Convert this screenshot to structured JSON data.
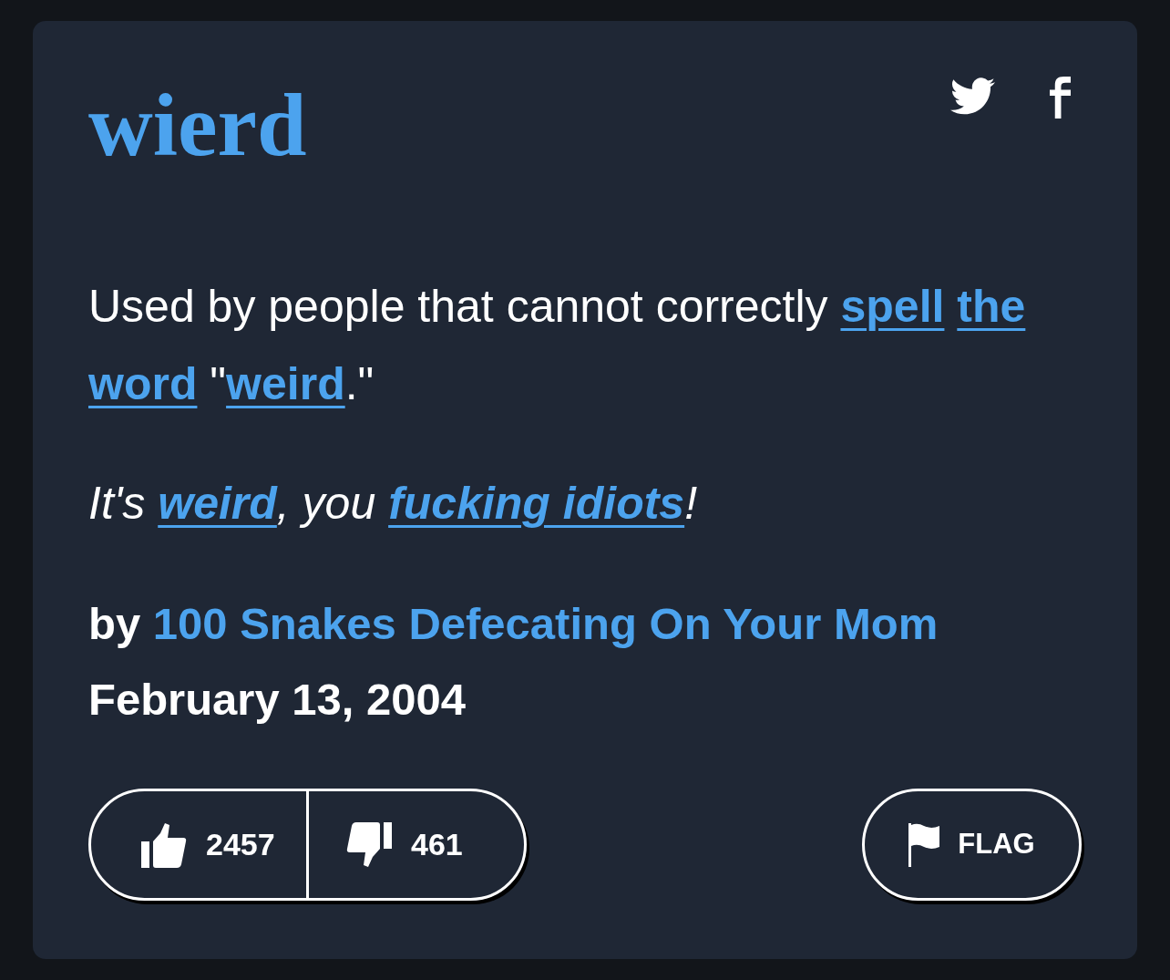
{
  "entry": {
    "word": "wierd"
  },
  "definition": [
    {
      "kind": "text",
      "text": "Used by people that cannot correctly "
    },
    {
      "kind": "link",
      "text": "spell",
      "space_after": true
    },
    {
      "kind": "link",
      "text": "the",
      "space_after": true
    },
    {
      "kind": "link",
      "text": "word"
    },
    {
      "kind": "text",
      "text": " \""
    },
    {
      "kind": "link",
      "text": "weird"
    },
    {
      "kind": "text",
      "text": ".\""
    }
  ],
  "example": [
    {
      "kind": "text",
      "text": "It's "
    },
    {
      "kind": "link",
      "text": "weird"
    },
    {
      "kind": "text",
      "text": ", you "
    },
    {
      "kind": "link",
      "text": "fucking idiots"
    },
    {
      "kind": "text",
      "text": "!"
    }
  ],
  "author": {
    "prefix": "by",
    "name": "100 Snakes Defecating On Your Mom"
  },
  "date": "February 13, 2004",
  "votes": [
    {
      "kind": "up",
      "count": "2457"
    },
    {
      "kind": "down",
      "count": "461"
    }
  ],
  "flag_button": {
    "label": "FLAG"
  }
}
